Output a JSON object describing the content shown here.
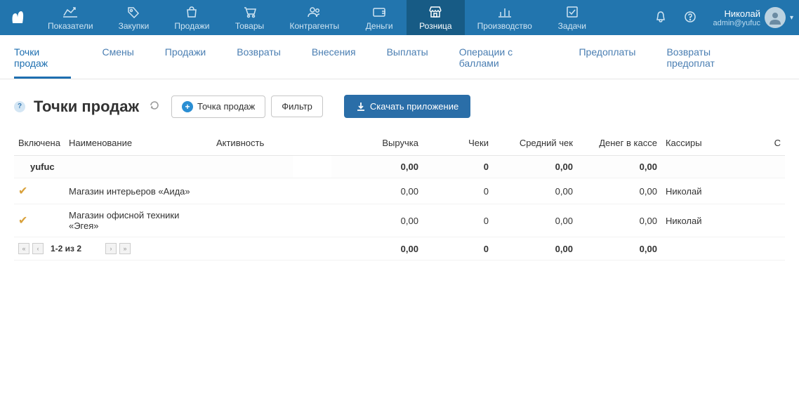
{
  "nav": [
    {
      "label": "Показатели"
    },
    {
      "label": "Закупки"
    },
    {
      "label": "Продажи"
    },
    {
      "label": "Товары"
    },
    {
      "label": "Контрагенты"
    },
    {
      "label": "Деньги"
    },
    {
      "label": "Розница"
    },
    {
      "label": "Производство"
    },
    {
      "label": "Задачи"
    }
  ],
  "user": {
    "name": "Николай",
    "login": "admin@yufuc"
  },
  "subnav": [
    "Точки продаж",
    "Смены",
    "Продажи",
    "Возвраты",
    "Внесения",
    "Выплаты",
    "Операции с баллами",
    "Предоплаты",
    "Возвраты предоплат"
  ],
  "page": {
    "title": "Точки продаж",
    "add_btn": "Точка продаж",
    "filter_btn": "Фильтр",
    "download_btn": "Скачать приложение"
  },
  "table": {
    "headers": {
      "enabled": "Включена",
      "name": "Наименование",
      "activity": "Активность",
      "revenue": "Выручка",
      "checks": "Чеки",
      "avg": "Средний чек",
      "cash": "Денег в кассе",
      "cashiers": "Кассиры",
      "last": "С"
    },
    "group": {
      "name": "yufuc",
      "revenue": "0,00",
      "checks": "0",
      "avg": "0,00",
      "cash": "0,00"
    },
    "rows": [
      {
        "name": "Магазин интерьеров «Аида»",
        "revenue": "0,00",
        "checks": "0",
        "avg": "0,00",
        "cash": "0,00",
        "cashier": "Николай"
      },
      {
        "name": "Магазин офисной техники «Эгея»",
        "revenue": "0,00",
        "checks": "0",
        "avg": "0,00",
        "cash": "0,00",
        "cashier": "Николай"
      }
    ],
    "total": {
      "revenue": "0,00",
      "checks": "0",
      "avg": "0,00",
      "cash": "0,00"
    },
    "pager": "1-2 из 2"
  }
}
